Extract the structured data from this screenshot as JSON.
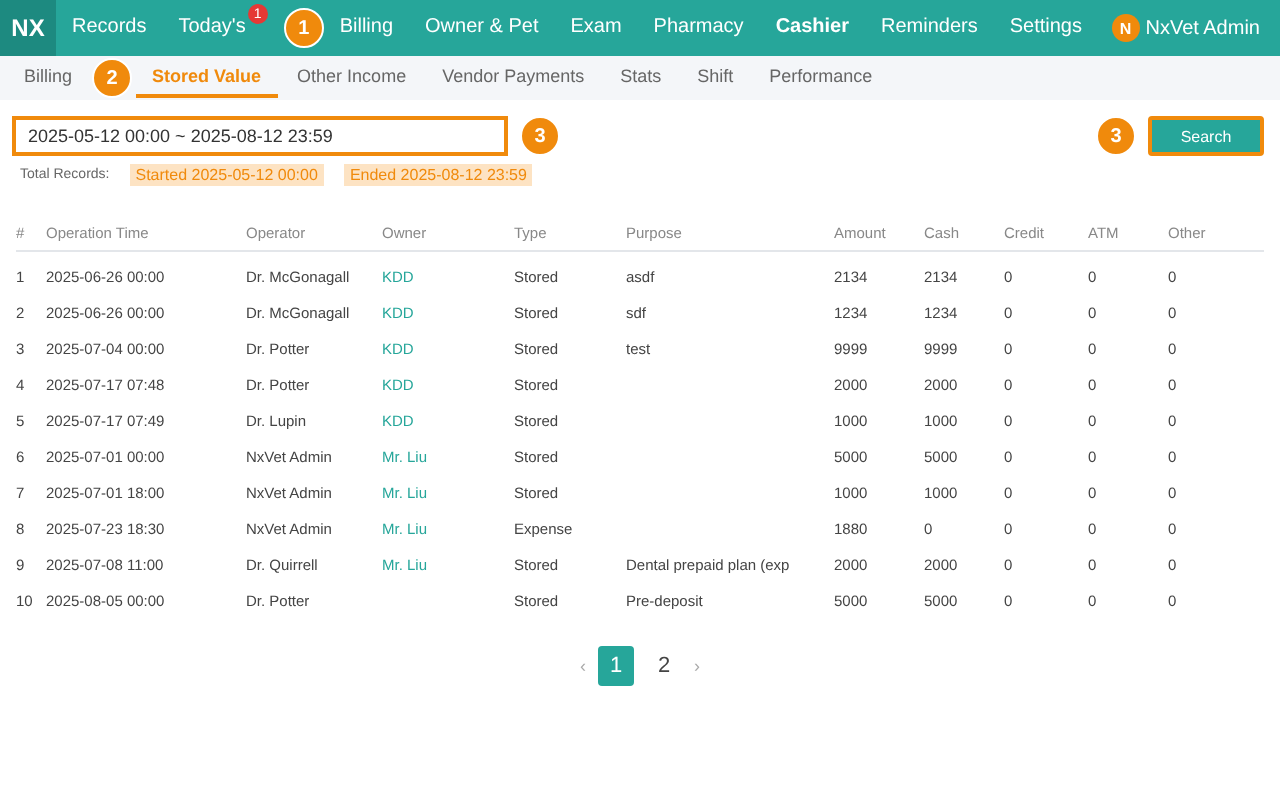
{
  "logo": "NX",
  "nav": [
    {
      "label": "Records",
      "selected": false
    },
    {
      "label": "Today's",
      "selected": false,
      "badge": "1"
    },
    {
      "label": "Billing",
      "selected": false
    },
    {
      "label": "Owner & Pet",
      "selected": false
    },
    {
      "label": "Exam",
      "selected": false
    },
    {
      "label": "Pharmacy",
      "selected": false
    },
    {
      "label": "Cashier",
      "selected": true
    },
    {
      "label": "Reminders",
      "selected": false
    },
    {
      "label": "Settings",
      "selected": false
    }
  ],
  "user": {
    "initial": "N",
    "name": "NxVet Admin"
  },
  "subtabs": [
    {
      "label": "Billing",
      "selected": false
    },
    {
      "label": "Stored Value",
      "selected": true
    },
    {
      "label": "Other Income",
      "selected": false
    },
    {
      "label": "Vendor Payments",
      "selected": false
    },
    {
      "label": "Stats",
      "selected": false
    },
    {
      "label": "Shift",
      "selected": false
    },
    {
      "label": "Performance",
      "selected": false
    }
  ],
  "date_range": {
    "value": "2025-05-12 00:00 ~ 2025-08-12 23:59"
  },
  "search_button": "Search",
  "summary": {
    "label": "Total Records:",
    "started": "Started 2025-05-12 00:00",
    "ended": "Ended 2025-08-12 23:59"
  },
  "table": {
    "columns": [
      "#",
      "Operation Time",
      "Operator",
      "Owner",
      "Type",
      "Purpose",
      "Amount",
      "Cash",
      "Credit",
      "ATM",
      "Other"
    ],
    "rows": [
      [
        "1",
        "2025-06-26 00:00",
        "Dr. McGonagall",
        "KDD",
        "Stored",
        "asdf",
        "2134",
        "2134",
        "0",
        "0",
        "0"
      ],
      [
        "2",
        "2025-06-26 00:00",
        "Dr. McGonagall",
        "KDD",
        "Stored",
        "sdf",
        "1234",
        "1234",
        "0",
        "0",
        "0"
      ],
      [
        "3",
        "2025-07-04 00:00",
        "Dr. Potter",
        "KDD",
        "Stored",
        "test",
        "9999",
        "9999",
        "0",
        "0",
        "0"
      ],
      [
        "4",
        "2025-07-17 07:48",
        "Dr. Potter",
        "KDD",
        "Stored",
        "",
        "2000",
        "2000",
        "0",
        "0",
        "0"
      ],
      [
        "5",
        "2025-07-17 07:49",
        "Dr. Lupin",
        "KDD",
        "Stored",
        "",
        "1000",
        "1000",
        "0",
        "0",
        "0"
      ],
      [
        "6",
        "2025-07-01 00:00",
        "NxVet Admin",
        "Mr. Liu",
        "Stored",
        "",
        "5000",
        "5000",
        "0",
        "0",
        "0"
      ],
      [
        "7",
        "2025-07-01 18:00",
        "NxVet Admin",
        "Mr. Liu",
        "Stored",
        "",
        "1000",
        "1000",
        "0",
        "0",
        "0"
      ],
      [
        "8",
        "2025-07-23 18:30",
        "NxVet Admin",
        "Mr. Liu",
        "Expense",
        "",
        "1880",
        "0",
        "0",
        "0",
        "0"
      ],
      [
        "9",
        "2025-07-08 11:00",
        "Dr. Quirrell",
        "Mr. Liu",
        "Stored",
        "Dental prepaid plan (exp",
        "2000",
        "2000",
        "0",
        "0",
        "0"
      ],
      [
        "10",
        "2025-08-05 00:00",
        "Dr. Potter",
        "",
        "Stored",
        "Pre-deposit",
        "5000",
        "5000",
        "0",
        "0",
        "0"
      ]
    ]
  },
  "pagination": {
    "prev": "‹",
    "next": "›",
    "pages": [
      {
        "label": "1",
        "selected": true
      },
      {
        "label": "2",
        "selected": false
      }
    ]
  },
  "annotations": [
    "1",
    "2",
    "3",
    "3"
  ]
}
